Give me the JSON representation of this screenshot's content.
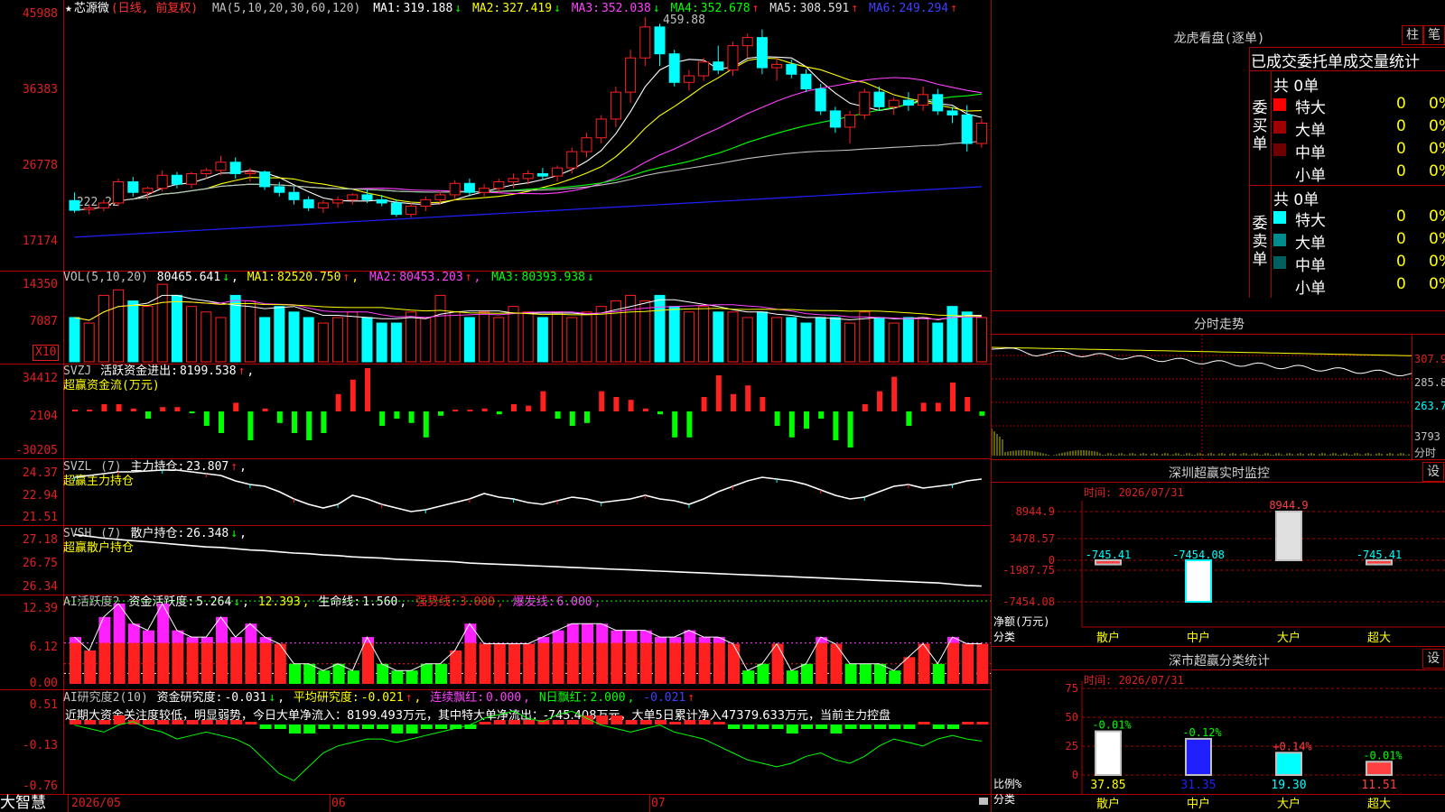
{
  "app": {
    "brand": "大智慧"
  },
  "colors": {
    "up": "#ff2020",
    "down": "#00ffff",
    "frame": "#b00000",
    "axis": "#e02020",
    "ma1": "#ffffff",
    "ma2": "#ffff00",
    "ma3": "#ff40ff",
    "ma4": "#00ff00",
    "ma5": "#c0c0c0",
    "ma6": "#2020ff"
  },
  "kline": {
    "star": "★",
    "name": "芯源微",
    "mode": "(日线, 前复权)",
    "ma_label": "MA(5,10,20,30,60,120)",
    "ma": [
      {
        "label": "MA1:",
        "value": "319.188",
        "arrow": "↓"
      },
      {
        "label": "MA2:",
        "value": "327.419",
        "arrow": "↓"
      },
      {
        "label": "MA3:",
        "value": "352.038",
        "arrow": "↓"
      },
      {
        "label": "MA4:",
        "value": "352.678",
        "arrow": "↑"
      },
      {
        "label": "MA5:",
        "value": "308.591",
        "arrow": "↑"
      },
      {
        "label": "MA6:",
        "value": "249.294",
        "arrow": "↑"
      }
    ],
    "y_labels": [
      "45988",
      "36383",
      "26778",
      "17174"
    ],
    "high_mark": "459.88",
    "low_mark": "←222.22",
    "candles": [
      [
        235,
        245,
        220,
        223
      ],
      [
        224,
        230,
        218,
        226
      ],
      [
        226,
        236,
        222,
        232
      ],
      [
        232,
        262,
        228,
        258
      ],
      [
        258,
        264,
        240,
        245
      ],
      [
        245,
        252,
        236,
        250
      ],
      [
        250,
        272,
        246,
        266
      ],
      [
        266,
        270,
        250,
        255
      ],
      [
        255,
        270,
        250,
        268
      ],
      [
        268,
        275,
        262,
        272
      ],
      [
        272,
        290,
        266,
        282
      ],
      [
        282,
        288,
        262,
        268
      ],
      [
        268,
        275,
        258,
        270
      ],
      [
        270,
        272,
        248,
        252
      ],
      [
        252,
        258,
        240,
        245
      ],
      [
        245,
        252,
        230,
        236
      ],
      [
        236,
        240,
        222,
        226
      ],
      [
        226,
        235,
        220,
        232
      ],
      [
        232,
        240,
        226,
        236
      ],
      [
        236,
        244,
        230,
        242
      ],
      [
        242,
        248,
        232,
        236
      ],
      [
        236,
        242,
        228,
        232
      ],
      [
        232,
        236,
        215,
        218
      ],
      [
        218,
        232,
        214,
        228
      ],
      [
        228,
        240,
        222,
        236
      ],
      [
        236,
        246,
        230,
        242
      ],
      [
        242,
        260,
        236,
        256
      ],
      [
        256,
        262,
        240,
        245
      ],
      [
        245,
        255,
        240,
        250
      ],
      [
        250,
        262,
        244,
        258
      ],
      [
        258,
        268,
        250,
        262
      ],
      [
        262,
        272,
        255,
        268
      ],
      [
        268,
        275,
        260,
        265
      ],
      [
        265,
        278,
        258,
        275
      ],
      [
        275,
        300,
        268,
        295
      ],
      [
        295,
        318,
        288,
        312
      ],
      [
        312,
        340,
        305,
        335
      ],
      [
        335,
        375,
        325,
        368
      ],
      [
        368,
        420,
        355,
        410
      ],
      [
        410,
        460,
        400,
        448
      ],
      [
        448,
        452,
        400,
        415
      ],
      [
        415,
        420,
        375,
        380
      ],
      [
        380,
        395,
        370,
        388
      ],
      [
        388,
        410,
        382,
        405
      ],
      [
        405,
        425,
        390,
        395
      ],
      [
        395,
        430,
        388,
        425
      ],
      [
        425,
        440,
        410,
        435
      ],
      [
        435,
        445,
        390,
        398
      ],
      [
        398,
        410,
        382,
        402
      ],
      [
        402,
        408,
        385,
        390
      ],
      [
        390,
        396,
        368,
        372
      ],
      [
        372,
        378,
        340,
        345
      ],
      [
        345,
        350,
        318,
        325
      ],
      [
        325,
        345,
        305,
        340
      ],
      [
        340,
        372,
        335,
        368
      ],
      [
        368,
        375,
        345,
        350
      ],
      [
        350,
        362,
        340,
        358
      ],
      [
        358,
        368,
        345,
        352
      ],
      [
        352,
        375,
        345,
        365
      ],
      [
        365,
        372,
        340,
        345
      ],
      [
        345,
        350,
        330,
        340
      ],
      [
        340,
        352,
        295,
        305
      ],
      [
        305,
        335,
        300,
        330
      ]
    ]
  },
  "vol": {
    "label": "VOL(5,10,20)",
    "value": "80465.641",
    "value_arrow": "↓",
    "ma": [
      {
        "label": "MA1:",
        "value": "82520.750",
        "arrow": "↑"
      },
      {
        "label": "MA2:",
        "value": "80453.203",
        "arrow": "↑"
      },
      {
        "label": "MA3:",
        "value": "80393.938",
        "arrow": "↓"
      }
    ],
    "y_labels": [
      "14350",
      "7087"
    ],
    "unit_badge": "X10",
    "values": [
      8,
      7,
      12,
      13,
      11,
      10,
      14,
      12,
      10,
      9,
      8,
      12,
      11,
      8,
      10,
      9,
      8,
      7,
      8,
      9,
      8,
      7,
      7,
      9,
      8,
      12,
      9,
      8,
      9,
      8,
      10,
      9,
      8,
      9,
      8,
      9,
      10,
      11,
      12,
      11,
      12,
      10,
      9,
      10,
      9,
      9,
      8,
      9,
      8,
      8,
      7,
      8,
      8,
      7,
      9,
      8,
      7,
      8,
      8,
      7,
      10,
      9,
      8
    ]
  },
  "svzj": {
    "name": "SVZJ",
    "desc": "活跃资金进出:",
    "value": "8199.538",
    "arrow": "↑",
    "trail": ",",
    "sub": "超赢资金流(万元)",
    "y_labels": [
      "34412",
      "2104",
      "-30205"
    ],
    "values": [
      1,
      1,
      5,
      5,
      2,
      -5,
      3,
      3,
      -1,
      -10,
      -15,
      6,
      -20,
      2,
      -8,
      -15,
      -20,
      -15,
      12,
      22,
      30,
      -10,
      -5,
      -8,
      -18,
      -3,
      1,
      1,
      2,
      -2,
      5,
      4,
      14,
      -5,
      -10,
      -8,
      14,
      10,
      8,
      2,
      -2,
      -18,
      -18,
      10,
      25,
      12,
      18,
      10,
      -10,
      -18,
      -12,
      -5,
      -20,
      -25,
      5,
      14,
      24,
      -10,
      6,
      6,
      20,
      10,
      -3
    ]
  },
  "svzl": {
    "name": "SVZL",
    "period": "(7)",
    "desc": "主力持仓:",
    "value": "23.807",
    "arrow": "↑",
    "trail": ",",
    "sub": "超赢主力持仓",
    "y_labels": [
      "24.37",
      "22.94",
      "21.51"
    ],
    "values": [
      23.8,
      23.9,
      24.0,
      24.1,
      24.1,
      24.15,
      24.2,
      24.2,
      24.1,
      24.0,
      23.9,
      23.6,
      23.4,
      23.3,
      23.0,
      22.6,
      22.3,
      22.1,
      22.3,
      22.8,
      22.6,
      22.3,
      22.1,
      21.9,
      22.0,
      22.2,
      22.4,
      22.6,
      22.9,
      22.7,
      22.6,
      22.4,
      22.3,
      22.5,
      22.7,
      22.6,
      22.4,
      22.5,
      22.6,
      22.8,
      22.6,
      22.5,
      22.3,
      22.6,
      23.0,
      23.3,
      23.6,
      23.8,
      23.7,
      23.6,
      23.4,
      23.1,
      22.8,
      22.6,
      22.7,
      23.0,
      23.3,
      23.4,
      23.2,
      23.3,
      23.4,
      23.6,
      23.7
    ]
  },
  "svsh": {
    "name": "SVSH",
    "period": "(7)",
    "desc": "散户持仓:",
    "value": "26.348",
    "arrow": "↓",
    "trail": ",",
    "sub": "超赢散户持仓",
    "y_labels": [
      "27.18",
      "26.75",
      "26.34"
    ],
    "values": [
      27.18,
      27.15,
      27.12,
      27.1,
      27.08,
      27.06,
      27.04,
      27.02,
      27.0,
      26.98,
      26.97,
      26.95,
      26.93,
      26.92,
      26.9,
      26.88,
      26.87,
      26.85,
      26.84,
      26.82,
      26.81,
      26.8,
      26.78,
      26.77,
      26.76,
      26.75,
      26.74,
      26.72,
      26.71,
      26.7,
      26.69,
      26.68,
      26.67,
      26.66,
      26.65,
      26.64,
      26.63,
      26.62,
      26.61,
      26.6,
      26.59,
      26.58,
      26.57,
      26.56,
      26.55,
      26.54,
      26.53,
      26.52,
      26.51,
      26.5,
      26.49,
      26.48,
      26.47,
      26.46,
      26.45,
      26.44,
      26.43,
      26.42,
      26.41,
      26.4,
      26.38,
      26.36,
      26.35
    ]
  },
  "ai_active": {
    "name": "AI活跃度2",
    "desc": "资金活跃度:",
    "value": "5.264",
    "arrow": "↓",
    "v2": "12.393",
    "life_label": "生命线:",
    "life": "1.560",
    "strong_label": "强势线:",
    "strong": "3.000",
    "burst_label": "爆发线:",
    "burst": "6.000",
    "y_labels": [
      "12.39",
      "6.12",
      "0.00"
    ],
    "values": [
      7,
      5,
      10,
      12,
      9,
      8,
      12,
      8,
      7,
      7,
      10,
      7,
      9,
      7,
      6,
      3,
      3,
      2,
      3,
      2,
      7,
      3,
      2,
      2,
      3,
      3,
      5,
      9,
      6,
      6,
      6,
      6,
      7,
      8,
      9,
      9,
      9,
      8,
      8,
      8,
      7,
      7,
      8,
      7,
      7,
      6,
      2,
      3,
      6,
      2,
      3,
      7,
      6,
      3,
      3,
      3,
      2,
      4,
      6,
      3,
      7,
      6,
      6
    ]
  },
  "ai_research": {
    "name": "AI研究度2(10)",
    "desc": "资金研究度:",
    "value": "-0.031",
    "arrow": "↓",
    "avg_label": "平均研究度:",
    "avg": "-0.021",
    "avg_arrow": "↑",
    "red_label": "连续飘红:",
    "red": "0.000",
    "nday_label": "N日飘红:",
    "nday": "2.000",
    "tail": "-0.021",
    "tail_arrow": "↑",
    "comment": "近期大资金关注度较低，明显弱势，今日大单净流入：8199.493万元，其中特大单净流出：-745.408万元，大单5日累计净入47379.633万元，当前主力控盘",
    "y_labels": [
      "0.51",
      "-0.13",
      "-0.76"
    ],
    "bars": [
      1,
      1,
      1,
      2,
      1,
      1,
      1,
      1,
      1,
      1,
      1,
      1,
      0,
      -1,
      -1,
      -2,
      -2,
      -1,
      -1,
      -1,
      -1,
      -1,
      -2,
      -2,
      -1,
      -1,
      -1,
      -1,
      0,
      1,
      1,
      1,
      1,
      1,
      1,
      2,
      2,
      2,
      1,
      1,
      1,
      0,
      1,
      1,
      0,
      -1,
      -1,
      -1,
      -1,
      -2,
      -1,
      -1,
      -2,
      -1,
      -1,
      -1,
      -1,
      -1,
      0,
      -1,
      -1,
      0,
      0
    ],
    "line": [
      0.1,
      0.05,
      0.0,
      0.1,
      0.15,
      0.05,
      0.0,
      -0.1,
      -0.05,
      0.0,
      -0.05,
      -0.1,
      -0.2,
      -0.4,
      -0.6,
      -0.7,
      -0.5,
      -0.3,
      -0.2,
      -0.15,
      -0.1,
      -0.1,
      -0.15,
      -0.1,
      -0.05,
      0.0,
      0.05,
      0.1,
      0.2,
      0.25,
      0.3,
      0.2,
      0.15,
      0.25,
      0.3,
      0.2,
      0.1,
      0.05,
      0.0,
      0.05,
      0.1,
      0.0,
      -0.05,
      -0.1,
      -0.2,
      -0.3,
      -0.4,
      -0.45,
      -0.5,
      -0.45,
      -0.35,
      -0.3,
      -0.4,
      -0.45,
      -0.35,
      -0.2,
      -0.1,
      -0.15,
      -0.2,
      -0.1,
      -0.05,
      -0.1,
      -0.13
    ]
  },
  "xaxis": {
    "labels": [
      "2026/05",
      "06",
      "07"
    ]
  },
  "lhb": {
    "title": "龙虎看盘(逐单)",
    "btn_bar": "柱",
    "btn_pen": "笔",
    "tabs": [
      "已成交",
      "委托单",
      "成交量统计"
    ],
    "buy_side": "委买单",
    "sell_side": "委卖单",
    "buy_total": "共 0单",
    "sell_total": "共 0单",
    "buy_rows": [
      {
        "name": "特大",
        "count": "0",
        "pct": "0%",
        "color": "#ff0000"
      },
      {
        "name": "大单",
        "count": "0",
        "pct": "0%",
        "color": "#a00000"
      },
      {
        "name": "中单",
        "count": "0",
        "pct": "0%",
        "color": "#700000"
      },
      {
        "name": "小单",
        "count": "0",
        "pct": "0%",
        "color": ""
      }
    ],
    "sell_rows": [
      {
        "name": "特大",
        "count": "0",
        "pct": "0%",
        "color": "#00ffff"
      },
      {
        "name": "大单",
        "count": "0",
        "pct": "0%",
        "color": "#008c8c"
      },
      {
        "name": "中单",
        "count": "0",
        "pct": "0%",
        "color": "#006060"
      },
      {
        "name": "小单",
        "count": "0",
        "pct": "0%",
        "color": ""
      }
    ]
  },
  "intraday": {
    "title": "分时走势",
    "y_labels": [
      "307.9",
      "285.8",
      "263.7",
      "3793"
    ],
    "unit": "分时"
  },
  "sz_monitor": {
    "title": "深圳超赢实时监控",
    "btn": "设",
    "time": "时间: 2026/07/31",
    "y_labels": [
      "8944.9",
      "3478.57",
      "0",
      "-1987.75",
      "-7454.08"
    ],
    "ylabel": "净额(万元)",
    "xlabel": "分类",
    "chart_data": {
      "type": "bar",
      "categories": [
        "散户",
        "中户",
        "大户",
        "超大"
      ],
      "values": [
        -745.41,
        -7454.08,
        8944.9,
        -745.41
      ],
      "value_labels": [
        "-745.41",
        "-7454.08",
        "8944.9",
        "-745.41"
      ],
      "ylim": [
        -7454.08,
        8944.9
      ]
    }
  },
  "classify": {
    "title": "深市超赢分类统计",
    "btn": "设",
    "time": "时间: 2026/07/31",
    "y_labels": [
      "75",
      "50",
      "25",
      "0"
    ],
    "ylabel": "比例%",
    "xlabel": "分类",
    "chart_data": {
      "type": "bar",
      "categories": [
        "散户",
        "中户",
        "大户",
        "超大"
      ],
      "values": [
        37.85,
        31.35,
        19.3,
        11.51
      ],
      "value_labels": [
        "37.85",
        "31.35",
        "19.30",
        "11.51"
      ],
      "change_labels": [
        "-0.01%",
        "-0.12%",
        "+0.14%",
        "-0.01%"
      ],
      "ylim": [
        0,
        75
      ]
    }
  }
}
